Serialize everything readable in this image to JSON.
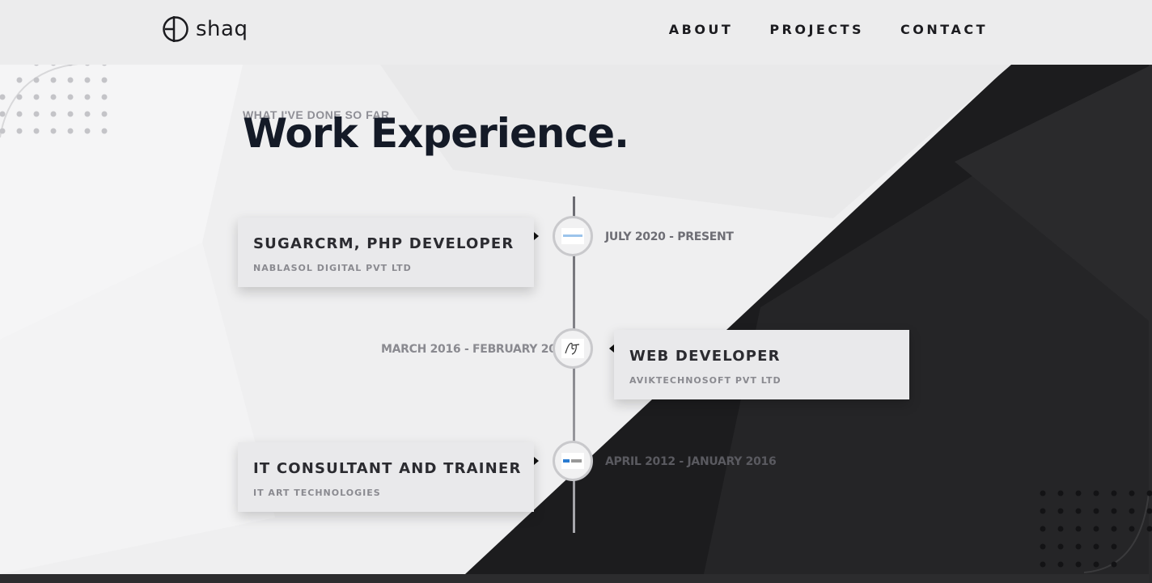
{
  "header": {
    "logo_text": "shaq",
    "nav": [
      {
        "label": "ABOUT"
      },
      {
        "label": "PROJECTS"
      },
      {
        "label": "CONTACT"
      }
    ]
  },
  "section": {
    "subtitle": "WHAT I'VE DONE SO FAR",
    "title": "Work Experience."
  },
  "experiences": [
    {
      "role": "SUGARCRM, PHP DEVELOPER",
      "company": "NABLASOL DIGITAL PVT LTD",
      "dates": "JULY 2020 - PRESENT",
      "logo_icon": "nablasol-logo-icon"
    },
    {
      "role": "WEB DEVELOPER",
      "company": "AVIKTECHNOSOFT PVT LTD",
      "dates": "MARCH 2016 - FEBRUARY 2020",
      "logo_icon": "aviktechnosoft-logo-icon"
    },
    {
      "role": "IT CONSULTANT AND TRAINER",
      "company": "IT ART TECHNOLOGIES",
      "dates": "APRIL 2012 - JANUARY 2016",
      "logo_icon": "itart-logo-icon"
    }
  ],
  "colors": {
    "light_bg": "#f0f0f1",
    "dark_bg": "#1d1d1f",
    "title": "#141a27",
    "subtitle": "#8f8f96"
  }
}
